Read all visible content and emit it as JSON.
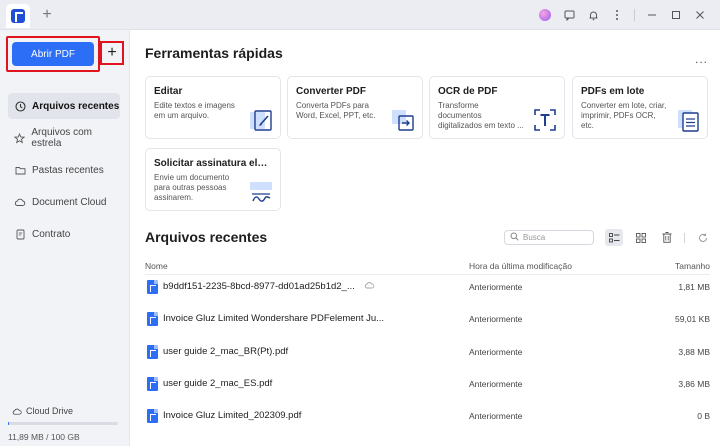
{
  "titlebar": {
    "new_tab_symbol": "+",
    "icons": [
      "app-logo-icon",
      "avatar",
      "feedback-icon",
      "bell-icon",
      "menu-icon",
      "minimize-icon",
      "maximize-icon",
      "close-icon"
    ]
  },
  "sidebar": {
    "open_pdf_label": "Abrir PDF",
    "add_symbol": "+",
    "items": [
      {
        "label": "Arquivos recentes",
        "icon": "clock-icon",
        "active": true
      },
      {
        "label": "Arquivos com estrela",
        "icon": "star-icon",
        "active": false
      },
      {
        "label": "Pastas recentes",
        "icon": "folder-icon",
        "active": false
      },
      {
        "label": "Document Cloud",
        "icon": "cloud-icon",
        "active": false
      },
      {
        "label": "Contrato",
        "icon": "contract-icon",
        "active": false
      }
    ],
    "cloud_drive_label": "Cloud Drive",
    "storage_text": "11,89 MB / 100 GB",
    "storage_fraction": 0.0001
  },
  "quick_tools": {
    "title": "Ferramentas rápidas",
    "more_label": "...",
    "cards": [
      {
        "title": "Editar",
        "desc": "Edite textos e imagens em um arquivo.",
        "icon": "edit-icon"
      },
      {
        "title": "Converter PDF",
        "desc": "Converta PDFs para Word, Excel, PPT, etc.",
        "icon": "convert-icon"
      },
      {
        "title": "OCR de PDF",
        "desc": "Transforme documentos digitalizados em texto ...",
        "icon": "ocr-icon"
      },
      {
        "title": "PDFs em lote",
        "desc": "Converter em lote, criar, imprimir, PDFs OCR, etc.",
        "icon": "batch-icon"
      },
      {
        "title": "Solicitar assinatura eletrô...",
        "desc": "Envie um documento para outras pessoas assinarem.",
        "icon": "signature-icon"
      }
    ]
  },
  "recent": {
    "title": "Arquivos recentes",
    "search_placeholder": "Busca",
    "columns": {
      "name": "Nome",
      "modified": "Hora da última modificação",
      "size": "Tamanho"
    },
    "files": [
      {
        "name": "b9ddf151-2235-8bcd-8977-dd01ad25b1d2_...",
        "modified": "Anteriormente",
        "size": "1,81 MB",
        "cloud": true
      },
      {
        "name": "Invoice Gluz Limited Wondershare PDFelement Ju...",
        "modified": "Anteriormente",
        "size": "59,01 KB",
        "cloud": false
      },
      {
        "name": "user guide 2_mac_BR(Pt).pdf",
        "modified": "Anteriormente",
        "size": "3,88 MB",
        "cloud": false
      },
      {
        "name": "user guide 2_mac_ES.pdf",
        "modified": "Anteriormente",
        "size": "3,86 MB",
        "cloud": false
      },
      {
        "name": "Invoice Gluz Limited_202309.pdf",
        "modified": "Anteriormente",
        "size": "0 B",
        "cloud": false
      }
    ]
  },
  "colors": {
    "accent": "#2c6ef5",
    "highlight": "#e0141e",
    "sidebar_bg": "#f2f3f6"
  }
}
